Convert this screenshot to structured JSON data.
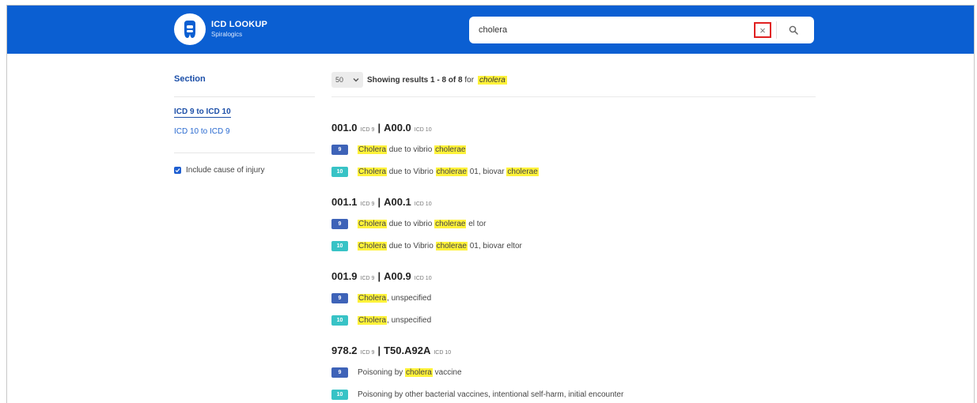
{
  "header": {
    "brand_title": "ICD LOOKUP",
    "brand_subtitle": "Spiralogics",
    "search_value": "cholera",
    "clear_icon": "×"
  },
  "sidebar": {
    "title": "Section",
    "links": [
      "ICD 9 to ICD 10",
      "ICD 10 to ICD 9"
    ],
    "active_index": 0,
    "checkbox_label": "Include cause of injury",
    "checkbox_checked": true
  },
  "results": {
    "per_page": "50",
    "showing_prefix": "Showing results",
    "range": "1 - 8 of 8",
    "for_word": "for",
    "query": "cholera",
    "groups": [
      {
        "icd9_code": "001.0",
        "icd9_tag": "ICD 9",
        "icd10_code": "A00.0",
        "icd10_tag": "ICD 10",
        "rows": [
          {
            "badge": "9",
            "parts": [
              {
                "t": "Cholera",
                "h": true
              },
              {
                "t": " due to vibrio ",
                "h": false
              },
              {
                "t": "cholerae",
                "h": true
              }
            ]
          },
          {
            "badge": "10",
            "parts": [
              {
                "t": "Cholera",
                "h": true
              },
              {
                "t": " due to Vibrio ",
                "h": false
              },
              {
                "t": "cholerae",
                "h": true
              },
              {
                "t": " 01, biovar ",
                "h": false
              },
              {
                "t": "cholerae",
                "h": true
              }
            ]
          }
        ]
      },
      {
        "icd9_code": "001.1",
        "icd9_tag": "ICD 9",
        "icd10_code": "A00.1",
        "icd10_tag": "ICD 10",
        "rows": [
          {
            "badge": "9",
            "parts": [
              {
                "t": "Cholera",
                "h": true
              },
              {
                "t": " due to vibrio ",
                "h": false
              },
              {
                "t": "cholerae",
                "h": true
              },
              {
                "t": " el tor",
                "h": false
              }
            ]
          },
          {
            "badge": "10",
            "parts": [
              {
                "t": "Cholera",
                "h": true
              },
              {
                "t": " due to Vibrio ",
                "h": false
              },
              {
                "t": "cholerae",
                "h": true
              },
              {
                "t": " 01, biovar eltor",
                "h": false
              }
            ]
          }
        ]
      },
      {
        "icd9_code": "001.9",
        "icd9_tag": "ICD 9",
        "icd10_code": "A00.9",
        "icd10_tag": "ICD 10",
        "rows": [
          {
            "badge": "9",
            "parts": [
              {
                "t": "Cholera",
                "h": true
              },
              {
                "t": ", unspecified",
                "h": false
              }
            ]
          },
          {
            "badge": "10",
            "parts": [
              {
                "t": "Cholera",
                "h": true
              },
              {
                "t": ", unspecified",
                "h": false
              }
            ]
          }
        ]
      },
      {
        "icd9_code": "978.2",
        "icd9_tag": "ICD 9",
        "icd10_code": "T50.A92A",
        "icd10_tag": "ICD 10",
        "rows": [
          {
            "badge": "9",
            "parts": [
              {
                "t": "Poisoning by ",
                "h": false
              },
              {
                "t": "cholera",
                "h": true
              },
              {
                "t": " vaccine",
                "h": false
              }
            ]
          },
          {
            "badge": "10",
            "parts": [
              {
                "t": "Poisoning by other bacterial vaccines, intentional self-harm, initial encounter",
                "h": false
              }
            ]
          }
        ]
      }
    ]
  },
  "colors": {
    "header_blue": "#0b5fd2",
    "link_blue": "#1c4fa8",
    "badge_icd9": "#3e63b8",
    "badge_icd10": "#38c3c6",
    "highlight": "#fff23a",
    "clear_border": "#e02020"
  },
  "icons": {
    "logo": "tooth-logo-icon",
    "clear": "close-icon",
    "search": "search-icon",
    "dropdown": "chevron-down-icon",
    "checkbox": "check-icon"
  }
}
